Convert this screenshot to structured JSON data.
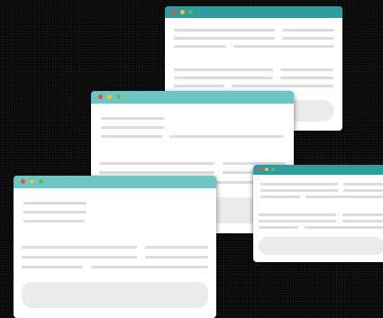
{
  "colors": {
    "background": "#0b0b0b",
    "titlebar_dark": "#2e9da0",
    "titlebar_light": "#6cc6c3",
    "dot_close": "#e64e4e",
    "dot_minimize": "#f2c233",
    "dot_maximize": "#5dba5a",
    "placeholder_line": "#dcdcdc",
    "placeholder_button": "#ebebeb"
  },
  "windows": [
    {
      "id": "win-top",
      "titlebar_color": "#2e9da0"
    },
    {
      "id": "win-middle",
      "titlebar_color": "#6cc6c3"
    },
    {
      "id": "win-front",
      "titlebar_color": "#6cc6c3"
    },
    {
      "id": "win-right",
      "titlebar_color": "#2e9da0"
    }
  ]
}
